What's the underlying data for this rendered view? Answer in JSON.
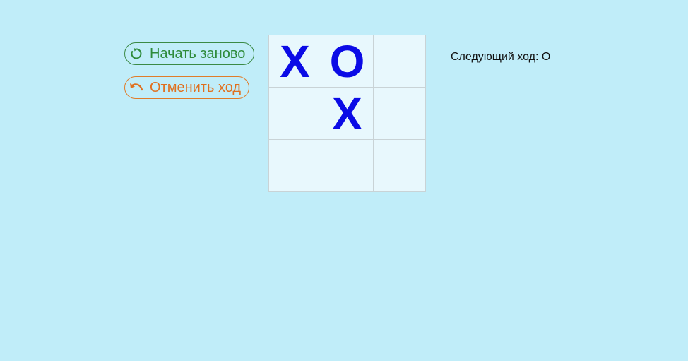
{
  "controls": {
    "restart_label": "Начать заново",
    "undo_label": "Отменить ход",
    "restart_color": "#2e8b3a",
    "undo_color": "#e0701f",
    "restart_icon": "refresh-icon",
    "undo_icon": "undo-icon"
  },
  "board": {
    "cells": [
      "X",
      "O",
      "",
      "",
      "X",
      "",
      "",
      "",
      ""
    ],
    "mark_color": "#0b0be6"
  },
  "status": {
    "text": "Следующий ход: O"
  },
  "colors": {
    "background": "#c0edf9",
    "cell_background": "#e8f8fd"
  }
}
